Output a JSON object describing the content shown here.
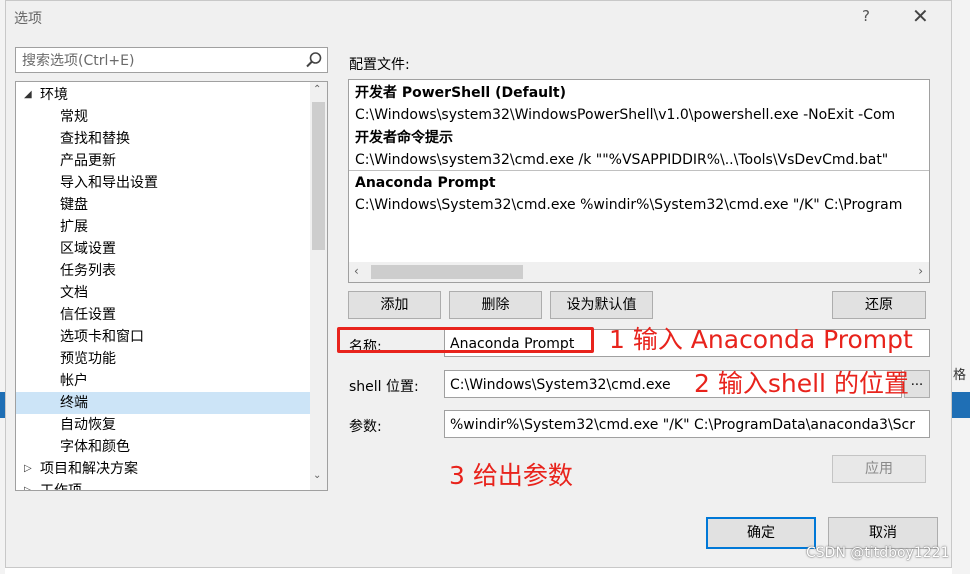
{
  "dialog": {
    "title": "选项",
    "help_glyph": "?",
    "close_glyph": "✕"
  },
  "search": {
    "placeholder": "搜索选项(Ctrl+E)"
  },
  "tree": {
    "items": [
      {
        "label": "环境",
        "level": 0,
        "expanded": true
      },
      {
        "label": "常规",
        "level": 1
      },
      {
        "label": "查找和替换",
        "level": 1
      },
      {
        "label": "产品更新",
        "level": 1
      },
      {
        "label": "导入和导出设置",
        "level": 1
      },
      {
        "label": "键盘",
        "level": 1
      },
      {
        "label": "扩展",
        "level": 1
      },
      {
        "label": "区域设置",
        "level": 1
      },
      {
        "label": "任务列表",
        "level": 1
      },
      {
        "label": "文档",
        "level": 1
      },
      {
        "label": "信任设置",
        "level": 1
      },
      {
        "label": "选项卡和窗口",
        "level": 1
      },
      {
        "label": "预览功能",
        "level": 1
      },
      {
        "label": "帐户",
        "level": 1
      },
      {
        "label": "终端",
        "level": 1,
        "selected": true
      },
      {
        "label": "自动恢复",
        "level": 1
      },
      {
        "label": "字体和颜色",
        "level": 1
      },
      {
        "label": "项目和解决方案",
        "level": 0,
        "expanded": false
      },
      {
        "label": "工作项",
        "level": 0,
        "expanded": false
      }
    ]
  },
  "profiles": {
    "label": "配置文件:",
    "items": [
      {
        "name": "开发者 PowerShell (Default)",
        "path": "C:\\Windows\\system32\\WindowsPowerShell\\v1.0\\powershell.exe -NoExit -Com"
      },
      {
        "name": "开发者命令提示",
        "path": "C:\\Windows\\system32\\cmd.exe /k \"\"%VSAPPIDDIR%\\..\\Tools\\VsDevCmd.bat\""
      },
      {
        "name": "Anaconda Prompt",
        "path": "C:\\Windows\\System32\\cmd.exe %windir%\\System32\\cmd.exe \"/K\" C:\\Program"
      }
    ]
  },
  "buttons": {
    "add": "添加",
    "delete": "删除",
    "set_default": "设为默认值",
    "restore": "还原",
    "apply": "应用",
    "ok": "确定",
    "cancel": "取消",
    "browse": "..."
  },
  "form": {
    "name_label": "名称:",
    "name_value": "Anaconda Prompt",
    "shell_label": "shell 位置:",
    "shell_value": "C:\\Windows\\System32\\cmd.exe",
    "args_label": "参数:",
    "args_value": "%windir%\\System32\\cmd.exe \"/K\" C:\\ProgramData\\anaconda3\\Scr"
  },
  "annotations": {
    "step1": "1 输入 Anaconda Prompt",
    "step2": "2 输入shell 的位置",
    "step3": "3 给出参数"
  },
  "background": {
    "side_char": "格"
  },
  "watermark": "CSDN @titdboy1221",
  "colors": {
    "annotation_red": "#e8231c",
    "selection_blue": "#cce4f7",
    "primary_border": "#0078d7"
  }
}
